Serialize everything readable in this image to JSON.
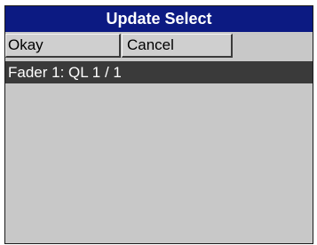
{
  "window": {
    "title": "Update Select"
  },
  "toolbar": {
    "okay_label": "Okay",
    "cancel_label": "Cancel"
  },
  "list": {
    "items": [
      {
        "label": "Fader 1: QL 1 / 1",
        "selected": true
      }
    ]
  },
  "colors": {
    "title_bar": "#0c1a82",
    "window_bg": "#c8c8c8",
    "selected_row": "#3a3a3a"
  }
}
